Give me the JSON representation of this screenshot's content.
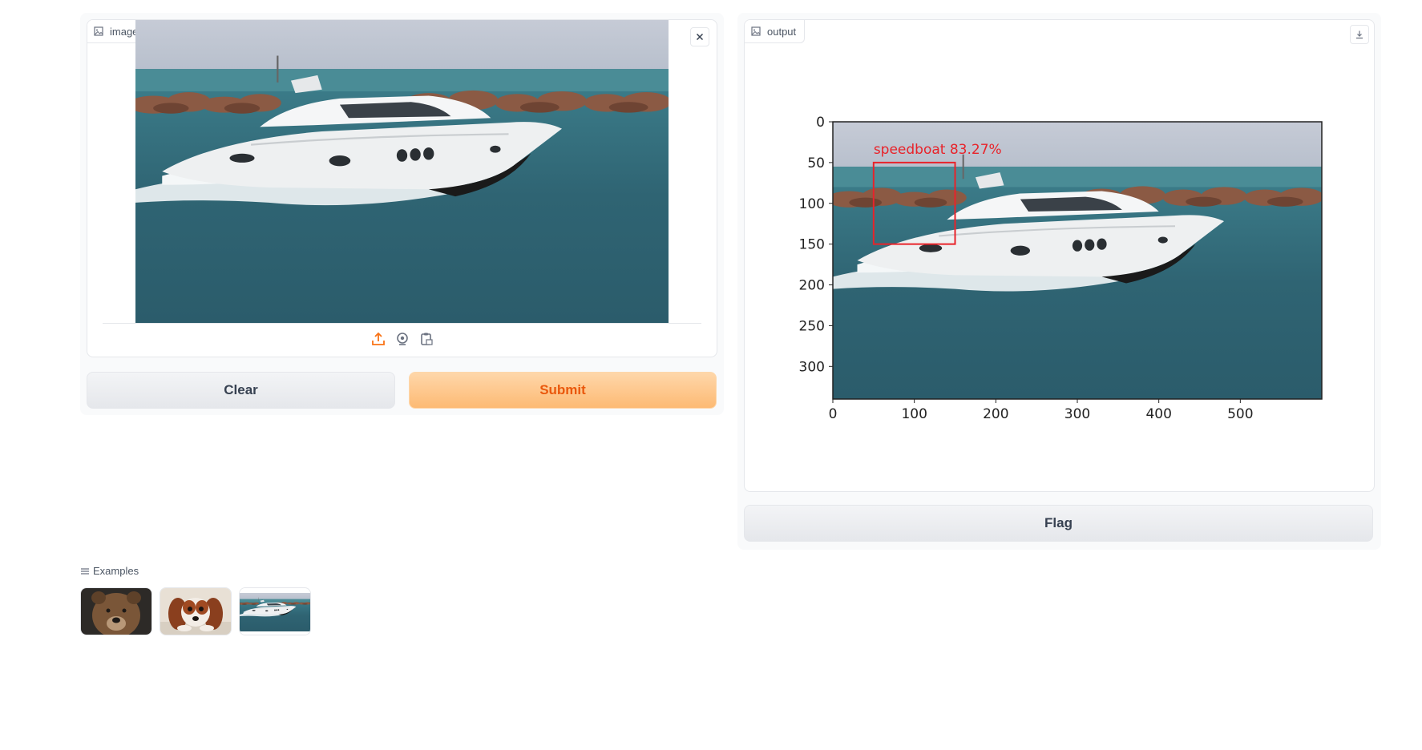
{
  "input": {
    "label": "image_array",
    "clear_label": "Clear",
    "submit_label": "Submit"
  },
  "output": {
    "label": "output",
    "flag_label": "Flag"
  },
  "examples": {
    "label": "Examples",
    "items": [
      "bear",
      "dog",
      "speedboat"
    ]
  },
  "colors": {
    "accent": "#f97316",
    "detection_box": "#e8232a"
  },
  "chart_data": {
    "type": "image",
    "detection_label": "speedboat 83.27%",
    "detection_box": {
      "x0": 50,
      "y0": 50,
      "x1": 150,
      "y1": 150
    },
    "x_ticks": [
      "0",
      "100",
      "200",
      "300",
      "400",
      "500"
    ],
    "y_ticks": [
      "0",
      "50",
      "100",
      "150",
      "200",
      "250",
      "300"
    ],
    "xlim": [
      0,
      600
    ],
    "ylim": [
      340,
      0
    ]
  }
}
